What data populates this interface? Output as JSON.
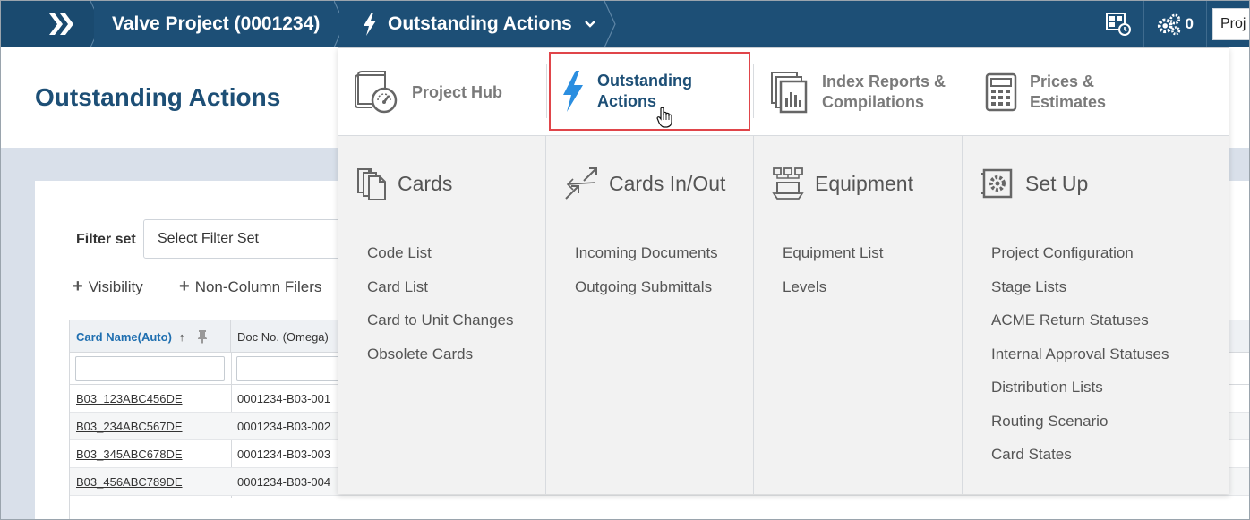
{
  "topbar": {
    "project_title": "Valve Project (0001234)",
    "section_title": "Outstanding Actions",
    "counter_value": "0",
    "proj_button": "Proj",
    "icons": [
      "double-chevron-icon",
      "bolt-icon",
      "chevron-down-icon",
      "dashboard-clock-icon",
      "gears-icon"
    ]
  },
  "page": {
    "title": "Outstanding Actions",
    "filter_label": "Filter set",
    "filter_placeholder": "Select Filter Set",
    "visibility_label": "Visibility",
    "non_column_label": "Non-Column Filers"
  },
  "grid": {
    "columns": [
      "Card Name(Auto)",
      "Doc No. (Omega)"
    ],
    "rows": [
      {
        "card": "B03_123ABC456DE",
        "doc": "0001234-B03-001"
      },
      {
        "card": "B03_234ABC567DE",
        "doc": "0001234-B03-002"
      },
      {
        "card": "B03_345ABC678DE",
        "doc": "0001234-B03-003"
      },
      {
        "card": "B03_456ABC789DE",
        "doc": "0001234-B03-004"
      }
    ]
  },
  "menu": {
    "hubs": [
      {
        "label1": "Project Hub",
        "label2": "",
        "icon": "gauge-icon"
      },
      {
        "label1": "Outstanding",
        "label2": "Actions",
        "icon": "bolt-icon",
        "active": true
      },
      {
        "label1": "Index Reports &",
        "label2": "Compilations",
        "icon": "report-stack-icon"
      },
      {
        "label1": "Prices &",
        "label2": "Estimates",
        "icon": "calculator-icon"
      }
    ],
    "columns": [
      {
        "title": "Cards",
        "icon": "cards-icon",
        "items": [
          "Code List",
          "Card List",
          "Card to Unit Changes",
          "Obsolete Cards"
        ]
      },
      {
        "title": "Cards In/Out",
        "icon": "arrows-in-out-icon",
        "items": [
          "Incoming Documents",
          "Outgoing Submittals"
        ]
      },
      {
        "title": "Equipment",
        "icon": "equipment-icon",
        "items": [
          "Equipment List",
          "Levels"
        ]
      },
      {
        "title": "Set Up",
        "icon": "settings-panel-icon",
        "items": [
          "Project Configuration",
          "Stage Lists",
          "ACME Return Statuses",
          "Internal Approval Statuses",
          "Distribution Lists",
          "Routing Scenario",
          "Card States"
        ]
      }
    ]
  },
  "colors": {
    "primary": "#1d4f76",
    "accent_border": "#e0454a",
    "link": "#1f6fb0"
  }
}
